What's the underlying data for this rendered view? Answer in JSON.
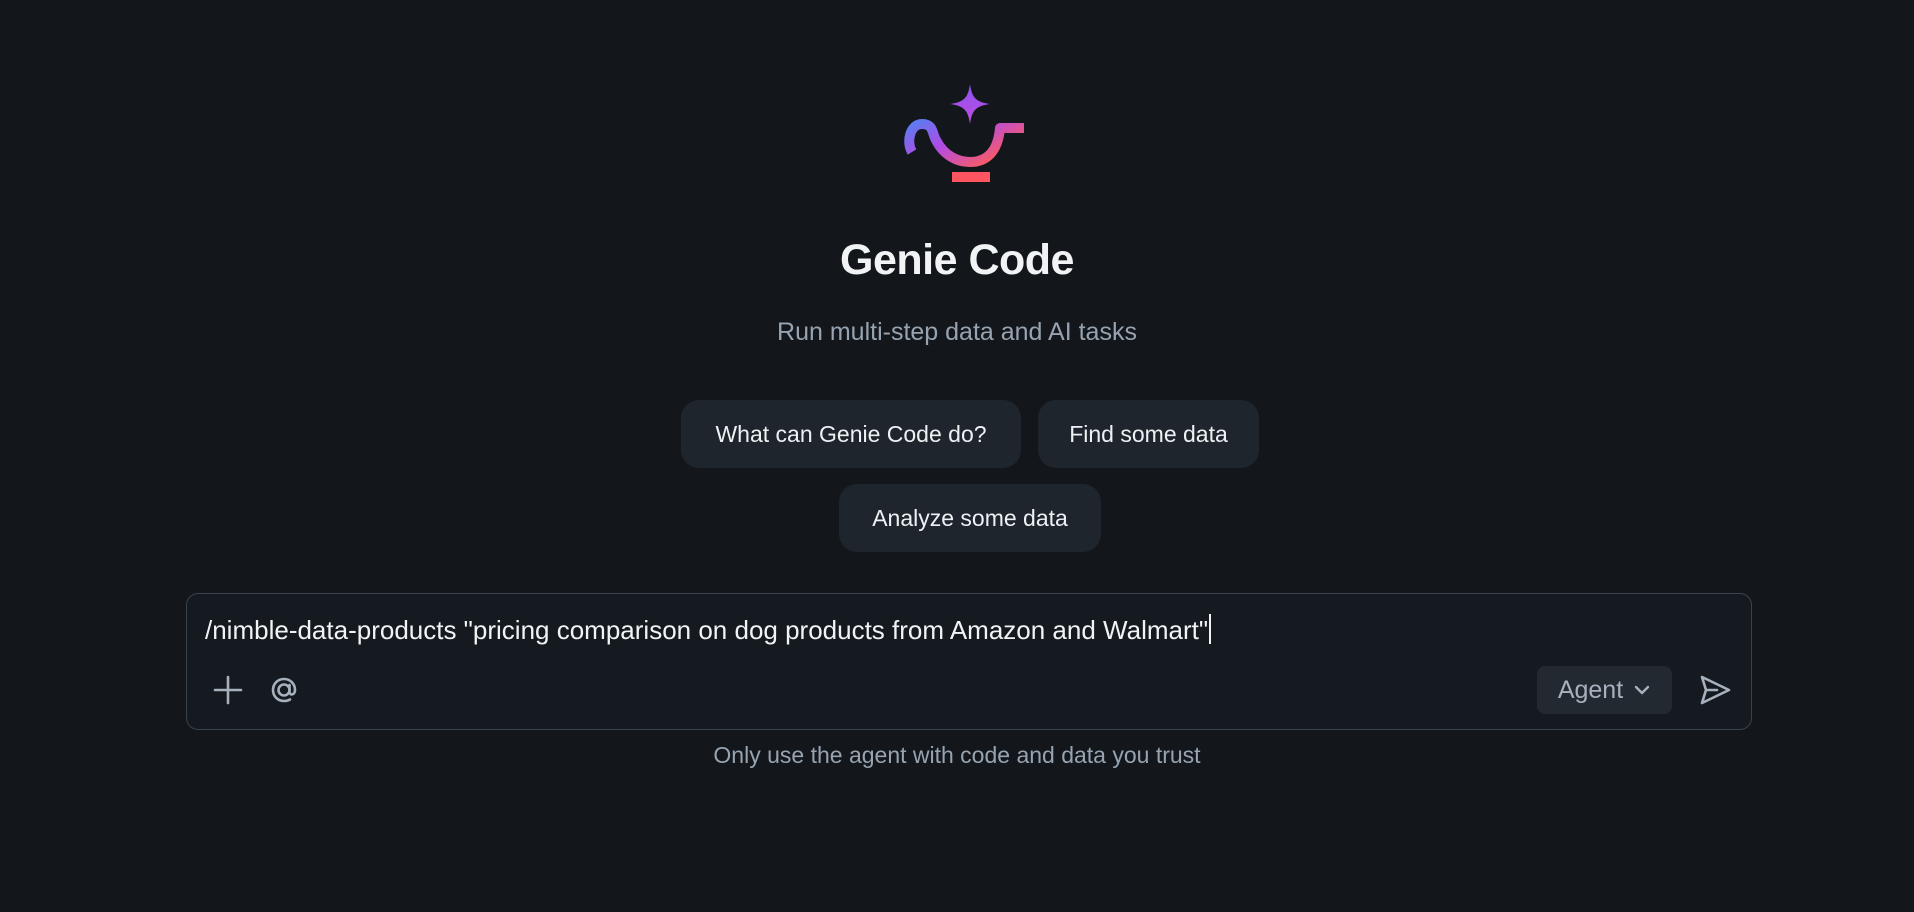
{
  "hero": {
    "title": "Genie Code",
    "subtitle": "Run multi-step data and AI tasks",
    "logo_icon": "genie-lamp-icon",
    "logo_colors": [
      "#5b7cf0",
      "#b04be8",
      "#ff5c5c"
    ]
  },
  "suggestions": [
    {
      "label": "What can Genie Code do?"
    },
    {
      "label": "Find some data"
    },
    {
      "label": "Analyze some data"
    }
  ],
  "composer": {
    "input_value": "/nimble-data-products \"pricing comparison on dog products from Amazon and Walmart\"",
    "attach_icon": "plus-icon",
    "mention_icon": "at-sign-icon",
    "mode_selected": "Agent",
    "mode_icon": "chevron-down-icon",
    "send_icon": "send-icon"
  },
  "disclaimer": "Only use the agent with code and data you trust",
  "colors": {
    "background": "#13171c",
    "chip_background": "#1f252c",
    "muted_text": "#97a3b0"
  }
}
